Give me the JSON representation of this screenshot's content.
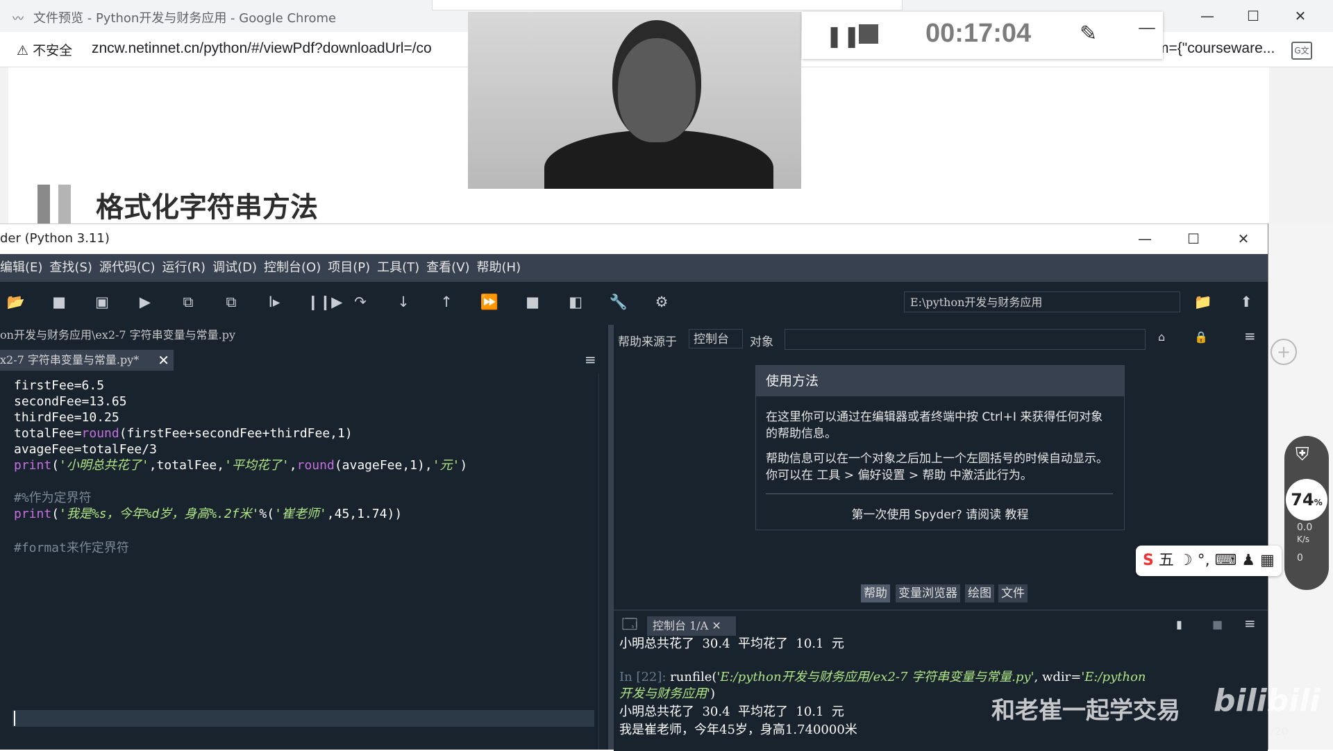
{
  "chrome": {
    "tab_title": "文件预览 - Python开发与财务应用 - Google Chrome",
    "security_label": "不安全",
    "url": "zncw.netinnet.cn/python/#/viewPdf?downloadUrl=/co",
    "url_tail": "m={\"courseware...",
    "favicon": "wave-icon",
    "translate_icon": "translate-icon"
  },
  "pdf": {
    "heading": "格式化字符串方法"
  },
  "recorder": {
    "elapsed": "00:17:04"
  },
  "spyder": {
    "window_title": "der (Python 3.11)",
    "menus": [
      "编辑(E)",
      "查找(S)",
      "源代码(C)",
      "运行(R)",
      "调试(D)",
      "控制台(O)",
      "项目(P)",
      "工具(T)",
      "查看(V)",
      "帮助(H)"
    ],
    "working_dir": "E:\\python开发与财务应用",
    "editor_path": "on开发与财务应用\\ex2-7 字符串变量与常量.py",
    "editor_tab": "x2-7 字符串变量与常量.py*",
    "code": {
      "l1": "firstFee=6.5",
      "l2": "secondFee=13.65",
      "l3": "thirdFee=10.25",
      "l4a": "totalFee=",
      "l4kw": "round",
      "l4b": "(firstFee+secondFee+thirdFee,1)",
      "l5": "avageFee=totalFee/3",
      "l6kw": "print",
      "l6a": "(",
      "l6s1": "'小明总共花了'",
      "l6b": ",totalFee,",
      "l6s2": "'平均花了'",
      "l6c": ",",
      "l6kw2": "round",
      "l6d": "(avageFee,1),",
      "l6s3": "'元'",
      "l6e": ")",
      "l8": "#%作为定界符",
      "l9kw": "print",
      "l9a": "(",
      "l9s": "'我是%s，今年%d岁，身高%.2f米'",
      "l9b": "%(",
      "l9s2": "'崔老师'",
      "l9c": ",45,1.74))",
      "l11": "#format来作定界符"
    },
    "help": {
      "source_label": "帮助来源于",
      "source_value": "控制台",
      "object_label": "对象",
      "card_title": "使用方法",
      "p1": "在这里你可以通过在编辑器或者终端中按 Ctrl+I 来获得任何对象的帮助信息。",
      "p2": "帮助信息可以在一个对象之后加上一个左圆括号的时候自动显示。你可以在 工具 > 偏好设置 > 帮助 中激活此行为。",
      "link": "第一次使用 Spyder? 请阅读 教程",
      "tabs": [
        "帮助",
        "变量浏览器",
        "绘图",
        "文件"
      ]
    },
    "console": {
      "tab": "控制台 1/A",
      "out1": "小明总共花了  30.4  平均花了  10.1  元",
      "in_prompt": "In [22]:",
      "in_cmd": " runfile(",
      "in_arg1": "'E:/python开发与财务应用/ex2-7 字符串变量与常量.py'",
      "in_mid": ", wdir=",
      "in_arg2a": "'E:/python",
      "in_arg2b": "开发与财务应用'",
      "in_close": ")",
      "out2": "小明总共花了  30.4  平均花了  10.1  元",
      "out3": "我是崔老师，今年45岁，身高1.740000米"
    }
  },
  "overlay": {
    "security_percent": "74",
    "speed_up": "0.0",
    "speed_unit": "K/s",
    "speed_down": "0",
    "ime_text": "五 ☽ °, ⌨ ♟ ▦",
    "watermark": "和老崔一起学交易",
    "watermark_logo": "bilibili",
    "page_count": "/20"
  }
}
